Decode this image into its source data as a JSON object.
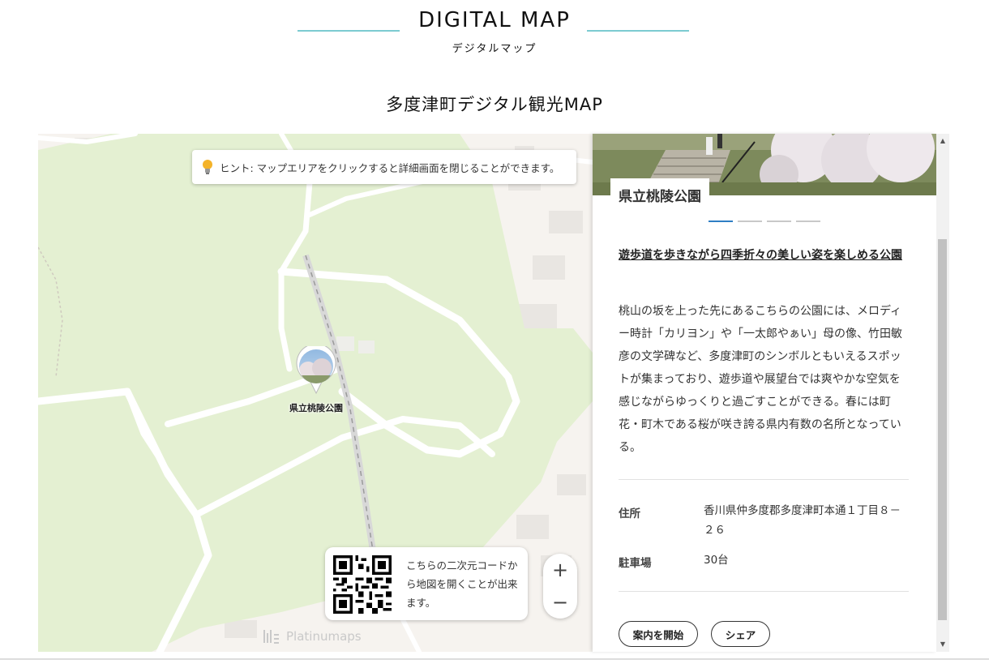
{
  "header": {
    "title": "DIGITAL MAP",
    "subtitle": "デジタルマップ"
  },
  "page_title": "多度津町デジタル観光MAP",
  "map": {
    "hint_text": "ヒント: マップエリアをクリックすると詳細画面を閉じることができます。",
    "pin_label": "県立桃陵公園",
    "qr_text": "こちらの二次元コードから地図を開くことが出来ます。",
    "zoom_in": "+",
    "zoom_out": "−",
    "brand": "Platinumaps",
    "colors": {
      "park": "#e4f0d2",
      "land": "#f6f3ef",
      "road": "#ffffff",
      "building": "#e9e6e2"
    }
  },
  "detail": {
    "name": "県立桃陵公園",
    "carousel_pages": 4,
    "carousel_active": 1,
    "catchphrase": "遊歩道を歩きながら四季折々の美しい姿を楽しめる公園",
    "description": "桃山の坂を上った先にあるこちらの公園には、メロディー時計「カリヨン」や「一太郎やぁい」母の像、竹田敏彦の文学碑など、多度津町のシンボルともいえるスポットが集まっており、遊歩道や展望台では爽やかな空気を感じながらゆっくりと過ごすことができる。春には町花・町木である桜が咲き誇る県内有数の名所となっている。",
    "address_label": "住所",
    "address_value": "香川県仲多度郡多度津町本通１丁目８－２６",
    "parking_label": "駐車場",
    "parking_value": "30台",
    "start_guide_label": "案内を開始",
    "share_label": "シェア",
    "accent_color": "#2e7ec4"
  }
}
